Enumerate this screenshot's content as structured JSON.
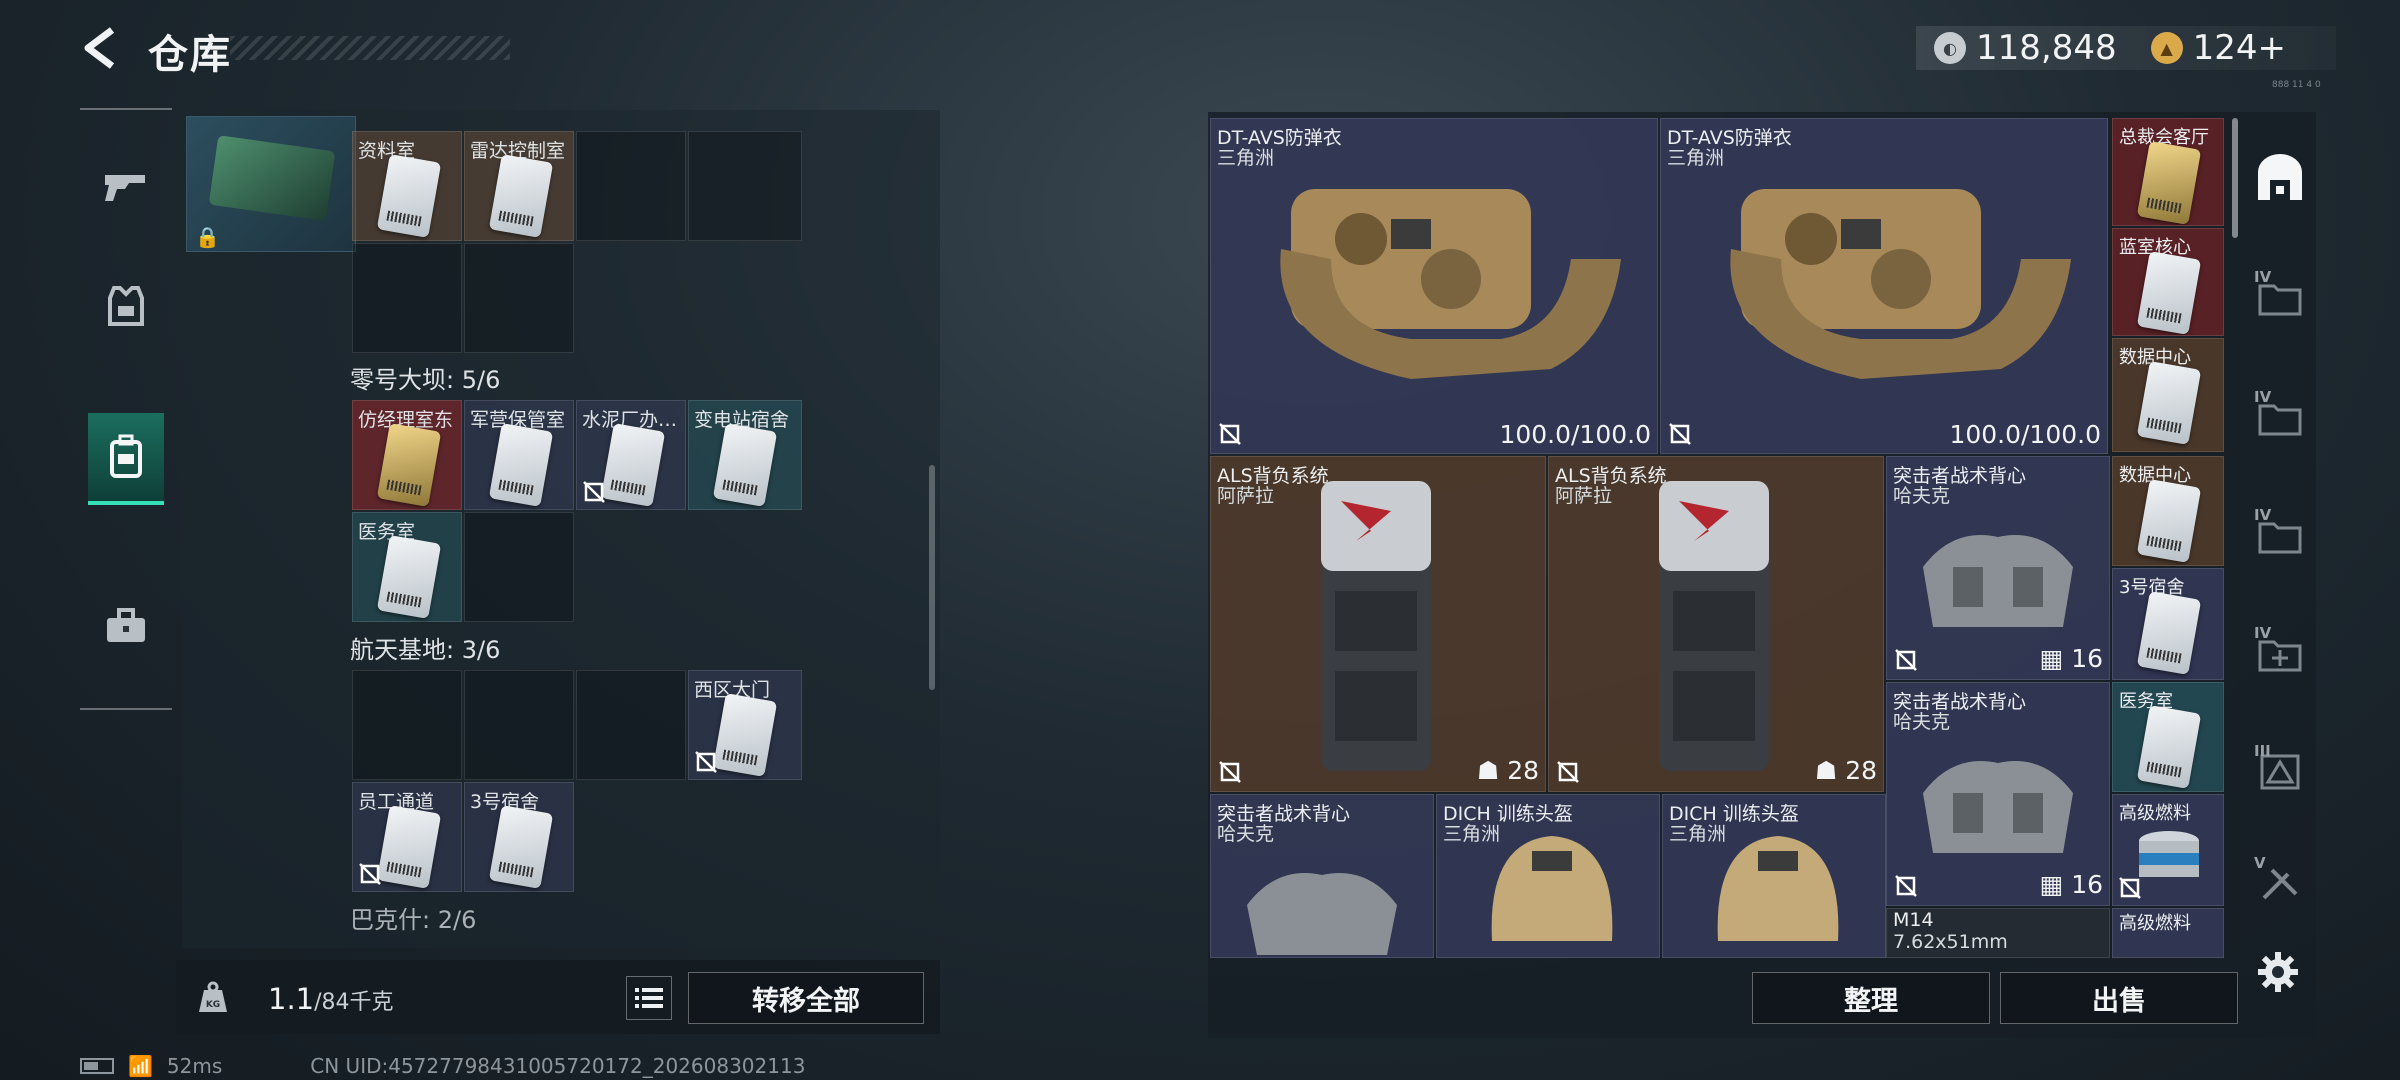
{
  "header": {
    "title": "仓库",
    "currency_a": "118,848",
    "currency_b": "124+",
    "version": "888 11 4 0"
  },
  "sidenav": [
    "gun-icon",
    "armor-vest-icon",
    "backpack-icon",
    "briefcase-icon"
  ],
  "left": {
    "sections": [
      {
        "title": "零号大坝: 5/6"
      },
      {
        "title": "航天基地: 3/6"
      },
      {
        "title": "巴克什: 2/6"
      }
    ],
    "row1": [
      "资料室",
      "雷达控制室"
    ],
    "row2": [
      "仿经理室东",
      "军营保管室",
      "水泥厂办…",
      "变电站宿舍"
    ],
    "row3": [
      "医务室"
    ],
    "row4": [
      "西区大门"
    ],
    "row5": [
      "员工通道",
      "3号宿舍"
    ]
  },
  "weight": {
    "value": "1.1",
    "max": "/84千克"
  },
  "buttons": {
    "transfer_all": "转移全部",
    "sort": "整理",
    "sell": "出售"
  },
  "status": {
    "ping": "52ms",
    "uid": "CN UID:457277984310057201​72_202608302113"
  },
  "items": {
    "vest1": {
      "name": "DT-AVS防弹衣",
      "origin": "三角洲",
      "durability": "100.0/100.0"
    },
    "vest2": {
      "name": "DT-AVS防弹衣",
      "origin": "三角洲",
      "durability": "100.0/100.0"
    },
    "bag1": {
      "name": "ALS背负系统",
      "origin": "阿萨拉",
      "count": "28"
    },
    "bag2": {
      "name": "ALS背负系统",
      "origin": "阿萨拉",
      "count": "28"
    },
    "rig1": {
      "name": "突击者战术背心",
      "origin": "哈夫克",
      "count": "16"
    },
    "rig2": {
      "name": "突击者战术背心",
      "origin": "哈夫克",
      "count": "16"
    },
    "rig3": {
      "name": "突击者战术背心",
      "origin": "哈夫克"
    },
    "helm1": {
      "name": "DICH 训练头盔",
      "origin": "三角洲"
    },
    "helm2": {
      "name": "DICH 训练头盔",
      "origin": "三角洲"
    },
    "m14": {
      "name": "M14",
      "origin": "7.62x51mm"
    },
    "keys": [
      "总裁会客厅",
      "蓝室核心",
      "数据中心",
      "数据中心",
      "3号宿舍",
      "医务室",
      "高级燃料",
      "高级燃料"
    ]
  },
  "vnav_tiers": [
    "IV",
    "IV",
    "IV",
    "IV",
    "III",
    "V"
  ],
  "colors": {
    "accent": "#35e0b6",
    "gold_card": "#e2c274",
    "red_slot": "#6e2226"
  }
}
